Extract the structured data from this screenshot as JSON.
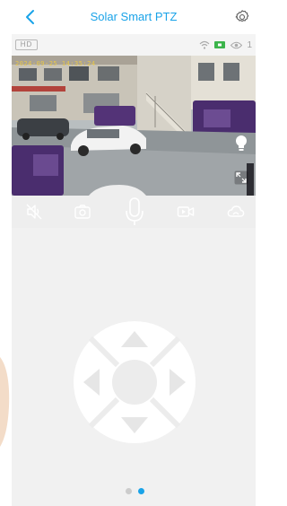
{
  "header": {
    "title": "Solar Smart PTZ"
  },
  "status": {
    "hd_label": "HD",
    "viewer_count": "1"
  },
  "video": {
    "timestamp": "2024-09-25 14:35:24"
  },
  "toolbar": {
    "items": [
      "mute",
      "snapshot",
      "talk",
      "record",
      "cloud"
    ]
  },
  "pager": {
    "page_count": 2,
    "active_page": 2
  },
  "colors": {
    "accent": "#1aa3e8",
    "toolbar_bg": "#eeeeee",
    "panel_bg": "#f1f1f1",
    "battery": "#3cb44b"
  }
}
